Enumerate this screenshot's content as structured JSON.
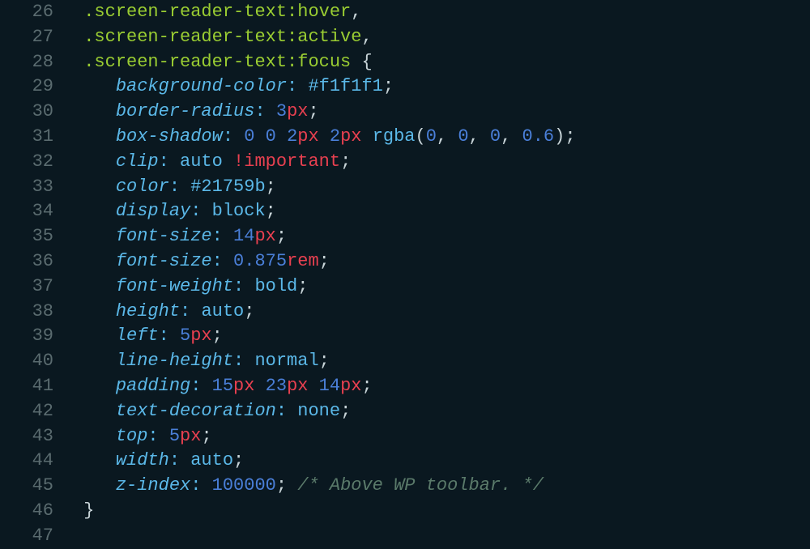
{
  "lines": [
    {
      "num": "26",
      "tokens": [
        {
          "t": ".screen-reader-text",
          "c": "selector"
        },
        {
          "t": ":hover",
          "c": "pseudo"
        },
        {
          "t": ",",
          "c": "comma-sep"
        }
      ],
      "indent": 1
    },
    {
      "num": "27",
      "tokens": [
        {
          "t": ".screen-reader-text",
          "c": "selector"
        },
        {
          "t": ":active",
          "c": "pseudo"
        },
        {
          "t": ",",
          "c": "comma-sep"
        }
      ],
      "indent": 1
    },
    {
      "num": "28",
      "tokens": [
        {
          "t": ".screen-reader-text",
          "c": "selector"
        },
        {
          "t": ":focus",
          "c": "pseudo"
        },
        {
          "t": " {",
          "c": "brace"
        }
      ],
      "indent": 1
    },
    {
      "num": "29",
      "tokens": [
        {
          "t": "background-color",
          "c": "property"
        },
        {
          "t": ":",
          "c": "colon"
        },
        {
          "t": " ",
          "c": ""
        },
        {
          "t": "#f1f1f1",
          "c": "hex"
        },
        {
          "t": ";",
          "c": "semicolon"
        }
      ],
      "indent": 4
    },
    {
      "num": "30",
      "tokens": [
        {
          "t": "border-radius",
          "c": "property"
        },
        {
          "t": ":",
          "c": "colon"
        },
        {
          "t": " ",
          "c": ""
        },
        {
          "t": "3",
          "c": "number"
        },
        {
          "t": "px",
          "c": "unit"
        },
        {
          "t": ";",
          "c": "semicolon"
        }
      ],
      "indent": 4
    },
    {
      "num": "31",
      "tokens": [
        {
          "t": "box-shadow",
          "c": "property"
        },
        {
          "t": ":",
          "c": "colon"
        },
        {
          "t": " ",
          "c": ""
        },
        {
          "t": "0",
          "c": "number"
        },
        {
          "t": " ",
          "c": ""
        },
        {
          "t": "0",
          "c": "number"
        },
        {
          "t": " ",
          "c": ""
        },
        {
          "t": "2",
          "c": "number"
        },
        {
          "t": "px",
          "c": "unit"
        },
        {
          "t": " ",
          "c": ""
        },
        {
          "t": "2",
          "c": "number"
        },
        {
          "t": "px",
          "c": "unit"
        },
        {
          "t": " ",
          "c": ""
        },
        {
          "t": "rgba",
          "c": "func"
        },
        {
          "t": "(",
          "c": "paren"
        },
        {
          "t": "0",
          "c": "number"
        },
        {
          "t": ", ",
          "c": "comma-sep"
        },
        {
          "t": "0",
          "c": "number"
        },
        {
          "t": ", ",
          "c": "comma-sep"
        },
        {
          "t": "0",
          "c": "number"
        },
        {
          "t": ", ",
          "c": "comma-sep"
        },
        {
          "t": "0.6",
          "c": "number"
        },
        {
          "t": ")",
          "c": "paren"
        },
        {
          "t": ";",
          "c": "semicolon"
        }
      ],
      "indent": 4
    },
    {
      "num": "32",
      "tokens": [
        {
          "t": "clip",
          "c": "property"
        },
        {
          "t": ":",
          "c": "colon"
        },
        {
          "t": " ",
          "c": ""
        },
        {
          "t": "auto",
          "c": "value-keyword"
        },
        {
          "t": " ",
          "c": ""
        },
        {
          "t": "!important",
          "c": "important"
        },
        {
          "t": ";",
          "c": "semicolon"
        }
      ],
      "indent": 4
    },
    {
      "num": "33",
      "tokens": [
        {
          "t": "color",
          "c": "property"
        },
        {
          "t": ":",
          "c": "colon"
        },
        {
          "t": " ",
          "c": ""
        },
        {
          "t": "#21759b",
          "c": "hex"
        },
        {
          "t": ";",
          "c": "semicolon"
        }
      ],
      "indent": 4
    },
    {
      "num": "34",
      "tokens": [
        {
          "t": "display",
          "c": "property"
        },
        {
          "t": ":",
          "c": "colon"
        },
        {
          "t": " ",
          "c": ""
        },
        {
          "t": "block",
          "c": "value-keyword"
        },
        {
          "t": ";",
          "c": "semicolon"
        }
      ],
      "indent": 4
    },
    {
      "num": "35",
      "tokens": [
        {
          "t": "font-size",
          "c": "property"
        },
        {
          "t": ":",
          "c": "colon"
        },
        {
          "t": " ",
          "c": ""
        },
        {
          "t": "14",
          "c": "number"
        },
        {
          "t": "px",
          "c": "unit"
        },
        {
          "t": ";",
          "c": "semicolon"
        }
      ],
      "indent": 4
    },
    {
      "num": "36",
      "tokens": [
        {
          "t": "font-size",
          "c": "property"
        },
        {
          "t": ":",
          "c": "colon"
        },
        {
          "t": " ",
          "c": ""
        },
        {
          "t": "0.875",
          "c": "number"
        },
        {
          "t": "rem",
          "c": "unit"
        },
        {
          "t": ";",
          "c": "semicolon"
        }
      ],
      "indent": 4
    },
    {
      "num": "37",
      "tokens": [
        {
          "t": "font-weight",
          "c": "property"
        },
        {
          "t": ":",
          "c": "colon"
        },
        {
          "t": " ",
          "c": ""
        },
        {
          "t": "bold",
          "c": "value-keyword"
        },
        {
          "t": ";",
          "c": "semicolon"
        }
      ],
      "indent": 4
    },
    {
      "num": "38",
      "tokens": [
        {
          "t": "height",
          "c": "property"
        },
        {
          "t": ":",
          "c": "colon"
        },
        {
          "t": " ",
          "c": ""
        },
        {
          "t": "auto",
          "c": "value-keyword"
        },
        {
          "t": ";",
          "c": "semicolon"
        }
      ],
      "indent": 4
    },
    {
      "num": "39",
      "tokens": [
        {
          "t": "left",
          "c": "property"
        },
        {
          "t": ":",
          "c": "colon"
        },
        {
          "t": " ",
          "c": ""
        },
        {
          "t": "5",
          "c": "number"
        },
        {
          "t": "px",
          "c": "unit"
        },
        {
          "t": ";",
          "c": "semicolon"
        }
      ],
      "indent": 4
    },
    {
      "num": "40",
      "tokens": [
        {
          "t": "line-height",
          "c": "property"
        },
        {
          "t": ":",
          "c": "colon"
        },
        {
          "t": " ",
          "c": ""
        },
        {
          "t": "normal",
          "c": "value-keyword"
        },
        {
          "t": ";",
          "c": "semicolon"
        }
      ],
      "indent": 4
    },
    {
      "num": "41",
      "tokens": [
        {
          "t": "padding",
          "c": "property"
        },
        {
          "t": ":",
          "c": "colon"
        },
        {
          "t": " ",
          "c": ""
        },
        {
          "t": "15",
          "c": "number"
        },
        {
          "t": "px",
          "c": "unit"
        },
        {
          "t": " ",
          "c": ""
        },
        {
          "t": "23",
          "c": "number"
        },
        {
          "t": "px",
          "c": "unit"
        },
        {
          "t": " ",
          "c": ""
        },
        {
          "t": "14",
          "c": "number"
        },
        {
          "t": "px",
          "c": "unit"
        },
        {
          "t": ";",
          "c": "semicolon"
        }
      ],
      "indent": 4
    },
    {
      "num": "42",
      "tokens": [
        {
          "t": "text-decoration",
          "c": "property"
        },
        {
          "t": ":",
          "c": "colon"
        },
        {
          "t": " ",
          "c": ""
        },
        {
          "t": "none",
          "c": "value-keyword"
        },
        {
          "t": ";",
          "c": "semicolon"
        }
      ],
      "indent": 4
    },
    {
      "num": "43",
      "tokens": [
        {
          "t": "top",
          "c": "property"
        },
        {
          "t": ":",
          "c": "colon"
        },
        {
          "t": " ",
          "c": ""
        },
        {
          "t": "5",
          "c": "number"
        },
        {
          "t": "px",
          "c": "unit"
        },
        {
          "t": ";",
          "c": "semicolon"
        }
      ],
      "indent": 4
    },
    {
      "num": "44",
      "tokens": [
        {
          "t": "width",
          "c": "property"
        },
        {
          "t": ":",
          "c": "colon"
        },
        {
          "t": " ",
          "c": ""
        },
        {
          "t": "auto",
          "c": "value-keyword"
        },
        {
          "t": ";",
          "c": "semicolon"
        }
      ],
      "indent": 4
    },
    {
      "num": "45",
      "tokens": [
        {
          "t": "z-index",
          "c": "property"
        },
        {
          "t": ":",
          "c": "colon"
        },
        {
          "t": " ",
          "c": ""
        },
        {
          "t": "100000",
          "c": "number"
        },
        {
          "t": ";",
          "c": "semicolon"
        },
        {
          "t": " ",
          "c": ""
        },
        {
          "t": "/* Above WP toolbar. */",
          "c": "comment"
        }
      ],
      "indent": 4
    },
    {
      "num": "46",
      "tokens": [
        {
          "t": "}",
          "c": "brace"
        }
      ],
      "indent": 1
    },
    {
      "num": "47",
      "tokens": [],
      "indent": 0
    }
  ]
}
